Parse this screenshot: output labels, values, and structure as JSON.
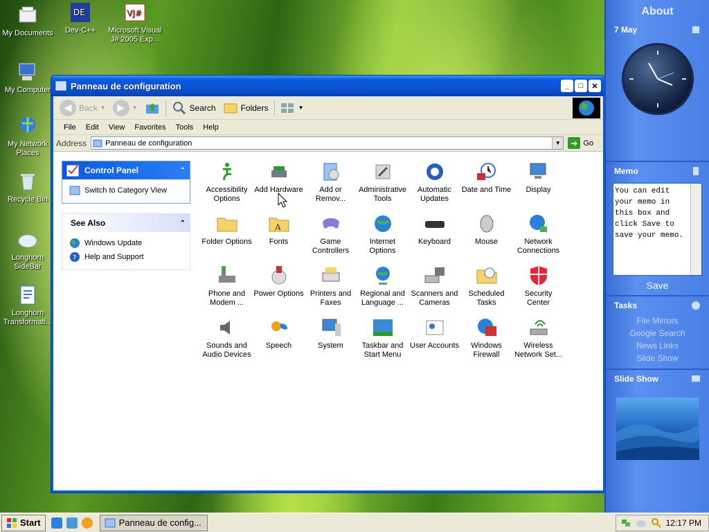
{
  "desktop": {
    "icons": [
      {
        "label": "My Documents"
      },
      {
        "label": "Dev-C++"
      },
      {
        "label": "Microsoft Visual J# 2005 Exp..."
      },
      {
        "label": "My Computer"
      },
      {
        "label": "My Network Places"
      },
      {
        "label": "Recycle Bin"
      },
      {
        "label": "Longhorn SideBar"
      },
      {
        "label": "Longhorn Transformati..."
      }
    ]
  },
  "window": {
    "title": "Panneau de configuration",
    "toolbar": {
      "back": "Back",
      "search": "Search",
      "folders": "Folders"
    },
    "menu": [
      "File",
      "Edit",
      "View",
      "Favorites",
      "Tools",
      "Help"
    ],
    "address_label": "Address",
    "address_value": "Panneau de configuration",
    "go": "Go",
    "left": {
      "control_panel": {
        "title": "Control Panel",
        "link": "Switch to Category View"
      },
      "see_also": {
        "title": "See Also",
        "links": [
          "Windows Update",
          "Help and Support"
        ]
      }
    },
    "items": [
      {
        "label": "Accessibility Options",
        "icon": "accessibility-icon"
      },
      {
        "label": "Add Hardware",
        "icon": "hardware-icon"
      },
      {
        "label": "Add or Remov...",
        "icon": "add-remove-icon"
      },
      {
        "label": "Administrative Tools",
        "icon": "admin-tools-icon"
      },
      {
        "label": "Automatic Updates",
        "icon": "updates-icon"
      },
      {
        "label": "Date and Time",
        "icon": "clock-icon"
      },
      {
        "label": "Display",
        "icon": "display-icon"
      },
      {
        "label": "Folder Options",
        "icon": "folder-icon"
      },
      {
        "label": "Fonts",
        "icon": "fonts-icon"
      },
      {
        "label": "Game Controllers",
        "icon": "gamepad-icon"
      },
      {
        "label": "Internet Options",
        "icon": "globe-icon"
      },
      {
        "label": "Keyboard",
        "icon": "keyboard-icon"
      },
      {
        "label": "Mouse",
        "icon": "mouse-icon"
      },
      {
        "label": "Network Connections",
        "icon": "network-icon"
      },
      {
        "label": "Phone and Modem ...",
        "icon": "phone-icon"
      },
      {
        "label": "Power Options",
        "icon": "power-icon"
      },
      {
        "label": "Printers and Faxes",
        "icon": "printer-icon"
      },
      {
        "label": "Regional and Language ...",
        "icon": "globe-stand-icon"
      },
      {
        "label": "Scanners and Cameras",
        "icon": "scanner-icon"
      },
      {
        "label": "Scheduled Tasks",
        "icon": "scheduled-tasks-icon"
      },
      {
        "label": "Security Center",
        "icon": "shield-icon"
      },
      {
        "label": "Sounds and Audio Devices",
        "icon": "speaker-icon"
      },
      {
        "label": "Speech",
        "icon": "speech-icon"
      },
      {
        "label": "System",
        "icon": "system-icon"
      },
      {
        "label": "Taskbar and Start Menu",
        "icon": "taskbar-icon"
      },
      {
        "label": "User Accounts",
        "icon": "user-accounts-icon"
      },
      {
        "label": "Windows Firewall",
        "icon": "firewall-icon"
      },
      {
        "label": "Wireless Network Set...",
        "icon": "wireless-icon"
      }
    ]
  },
  "sidebar": {
    "title": "About",
    "date": "7 May",
    "memo_head": "Memo",
    "memo_text": "You can edit your memo in this box and click Save to save your memo.",
    "save": "Save",
    "tasks_head": "Tasks",
    "tasks": [
      "File Mirrors",
      "Google Search",
      "News Links",
      "Slide Show"
    ],
    "slideshow_head": "Slide Show"
  },
  "taskbar": {
    "start": "Start",
    "task": "Panneau de config...",
    "time": "12:17 PM"
  },
  "colors": {
    "xp_blue": "#0a5ae0",
    "sidebar_blue": "#4a7fe6",
    "taskbar": "#ece9d8"
  }
}
